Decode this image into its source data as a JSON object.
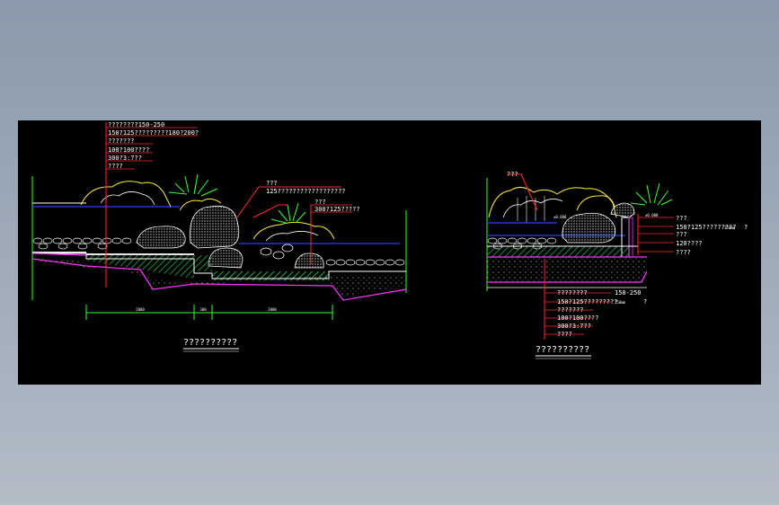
{
  "colors": {
    "background": "#000000",
    "outline": "#ffffff",
    "leader": "#ff2a2a",
    "water": "#2a3cff",
    "grade": "#ff33ff",
    "axis": "#33ff33",
    "rock_outline": "#ffee33",
    "hatch": "#22aa44",
    "plant": "#33ff33"
  },
  "left_section": {
    "title": "??????????",
    "top_labels": [
      "????????150-250",
      "150?125?????????180?200?",
      "???????",
      "100?100????",
      "300?3:7??",
      "????"
    ],
    "mid_labels": [
      "???",
      "125??????????????????"
    ],
    "side_labels": [
      "???",
      "300?125?????"
    ],
    "dimensions": [
      "2000",
      "300",
      "2000"
    ]
  },
  "right_section": {
    "title": "??????????",
    "top_label": "???",
    "side_labels": [
      "???",
      "150?125?????????",
      "???",
      "120????",
      "????"
    ],
    "side_label_suffix": "?",
    "side_label_note": "150mm",
    "bottom_labels": [
      "????????",
      "150?125?????????",
      "???????",
      "100?100????",
      "300?3:7??",
      "????"
    ],
    "bottom_label_suffixes": [
      "150-250",
      "?"
    ],
    "bottom_label_note": "150mm",
    "levels": [
      "±0.000",
      "±0.000"
    ]
  }
}
